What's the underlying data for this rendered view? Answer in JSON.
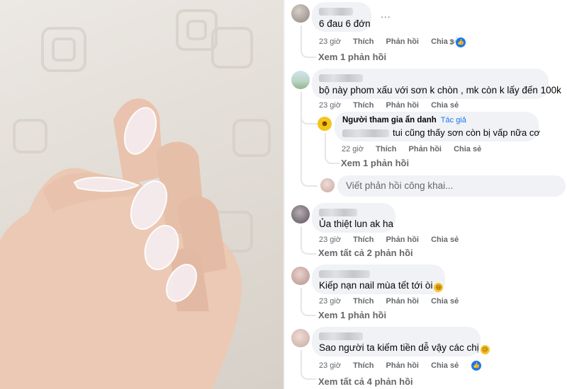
{
  "photo": {
    "description_icon": "hand-photo"
  },
  "comments": [
    {
      "text": "6 đau 6 đớn",
      "time": "23 giờ",
      "like": "Thích",
      "reply": "Phản hồi",
      "share": "Chia sẻ",
      "reaction_count": "3",
      "more": "...",
      "view_replies": "Xem 1 phản hồi"
    },
    {
      "text": "bộ này phom xấu với sơn k chòn , mk còn k lấy đến 100k",
      "reply_item": {
        "author": "Người tham gia ẩn danh",
        "badge": "Tác giả",
        "text": "tui cũng thấy sơn còn bị vấp nữa cơ",
        "time": "22 giờ",
        "like": "Thích",
        "reply": "Phản hồi",
        "share": "Chia sẻ",
        "view_replies": "Xem 1 phản hồi"
      },
      "time": "23 giờ",
      "like": "Thích",
      "reply": "Phản hồi",
      "share": "Chia sẻ",
      "write_reply_placeholder": "Viết phản hồi công khai..."
    },
    {
      "text": "Ủa thiệt lun ak ha",
      "time": "23 giờ",
      "like": "Thích",
      "reply": "Phản hồi",
      "share": "Chia sẻ",
      "view_replies": "Xem tất cả 2 phản hồi"
    },
    {
      "text": "Kiếp nạn nail mùa tết tới òi",
      "time": "23 giờ",
      "like": "Thích",
      "reply": "Phản hồi",
      "share": "Chia sẻ",
      "view_replies": "Xem 1 phản hồi"
    },
    {
      "text": "Sao người ta kiếm tiền dễ vậy các chị",
      "time": "23 giờ",
      "like": "Thích",
      "reply": "Phản hồi",
      "share": "Chia sẻ",
      "view_replies": "Xem tất cả 4 phản hồi"
    }
  ],
  "colors": {
    "bubble": "#f0f2f5",
    "meta": "#65676b",
    "accent": "#1877f2"
  }
}
